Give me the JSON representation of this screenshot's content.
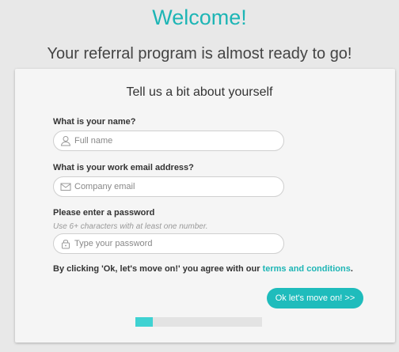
{
  "header": {
    "welcome": "Welcome!",
    "subtitle": "Your referral program is almost ready to go!"
  },
  "card": {
    "title": "Tell us a bit about yourself",
    "name": {
      "label": "What is your name?",
      "placeholder": "Full name",
      "value": "",
      "icon": "user-icon"
    },
    "email": {
      "label": "What is your work email address?",
      "placeholder": "Company email",
      "value": "",
      "icon": "envelope-icon"
    },
    "password": {
      "label": "Please enter a password",
      "hint": "Use 6+ characters with at least one number.",
      "placeholder": "Type your password",
      "value": "",
      "icon": "lock-icon"
    },
    "terms": {
      "text": "By clicking 'Ok, let's move on!' you agree with our ",
      "link": "terms and conditions",
      "suffix": "."
    },
    "submit_label": "Ok let's move on! >>",
    "progress": 0.14
  },
  "colors": {
    "accent": "#1db5b5",
    "button": "#1fbcbc",
    "progress_fill": "#3fd2d2"
  }
}
